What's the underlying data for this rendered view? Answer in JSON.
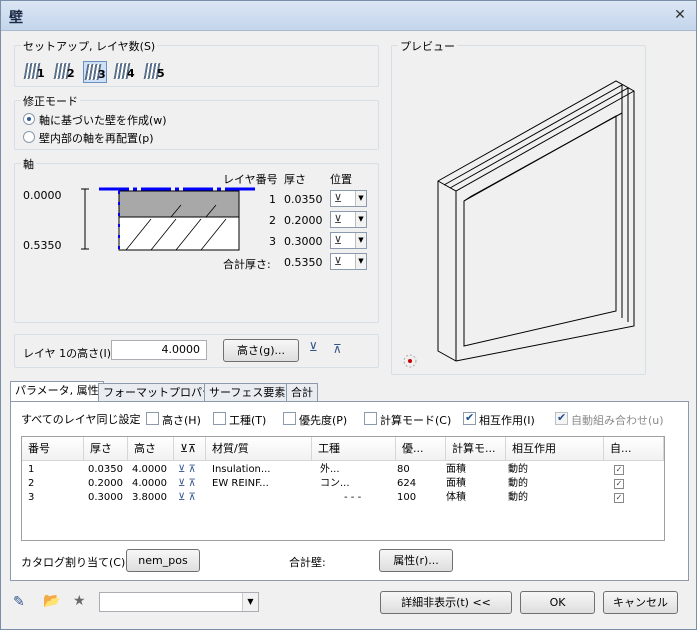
{
  "window": {
    "title": "壁",
    "close": "✕"
  },
  "setup": {
    "label": "セットアップ, レイヤ数(S)",
    "layers": [
      "1",
      "2",
      "3",
      "4",
      "5"
    ],
    "selected": "3"
  },
  "mode": {
    "label": "修正モード",
    "opt1": "軸に基づいた壁を作成(w)",
    "opt2": "壁内部の軸を再配置(p)"
  },
  "axis": {
    "label": "軸",
    "val_top": "0.0000",
    "val_bottom": "0.5350",
    "hdr_layer": "レイヤ番号",
    "hdr_thick": "厚さ",
    "hdr_pos": "位置",
    "rows": [
      {
        "no": "1",
        "thick": "0.0350"
      },
      {
        "no": "2",
        "thick": "0.2000"
      },
      {
        "no": "3",
        "thick": "0.3000"
      }
    ],
    "total_label": "合計厚さ:",
    "total": "0.5350"
  },
  "height": {
    "label": "レイヤ 1の高さ(I):",
    "value": "4.0000",
    "btn": "高さ(g)..."
  },
  "preview": {
    "label": "プレビュー"
  },
  "tabs": [
    "パラメータ, 属性",
    "フォーマットプロパティ",
    "サーフェス要素",
    "合計"
  ],
  "same": {
    "label": "すべてのレイヤ同じ設定",
    "height": "高さ(H)",
    "process": "工種(T)",
    "priority": "優先度(P)",
    "calcmode": "計算モード(C)",
    "interact": "相互作用(I)",
    "auto": "自動組み合わせ(u)"
  },
  "table": {
    "headers": [
      "番号",
      "厚さ",
      "高さ",
      "",
      "材質/質",
      "工種",
      "優...",
      "計算モ...",
      "相互作用",
      "自..."
    ],
    "rows": [
      [
        "1",
        "0.0350",
        "4.0000",
        "",
        "Insulation...",
        "外...",
        "80",
        "面積",
        "動的"
      ],
      [
        "2",
        "0.2000",
        "4.0000",
        "",
        "EW REINF...",
        "コン...",
        "624",
        "面積",
        "動的"
      ],
      [
        "3",
        "0.3000",
        "3.8000",
        "",
        "",
        "- - -",
        "100",
        "体積",
        "動的"
      ]
    ]
  },
  "catalog": {
    "label": "カタログ割り当て(C)",
    "btn": "nem_pos"
  },
  "total_wall": {
    "label": "合計壁:",
    "btn": "属性(r)..."
  },
  "bottom": {
    "details": "詳細非表示(t) <<",
    "ok": "OK",
    "cancel": "キャンセル"
  },
  "colors": {
    "accent": "#0000ff",
    "select": "#cde0f6"
  }
}
